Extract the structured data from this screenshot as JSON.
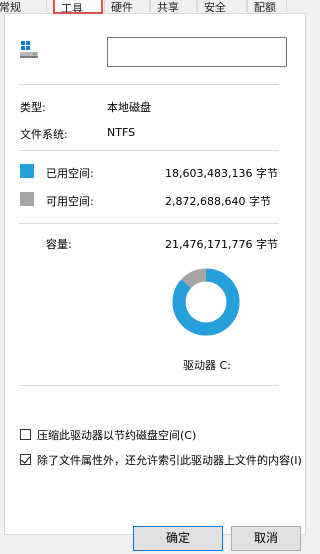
{
  "tabs": [
    {
      "label": "常规"
    },
    {
      "label": "工具"
    },
    {
      "label": "硬件"
    },
    {
      "label": "共享"
    },
    {
      "label": "安全"
    },
    {
      "label": "配额"
    }
  ],
  "drive_name_value": "",
  "type": {
    "label": "类型:",
    "value": "本地磁盘"
  },
  "filesystem": {
    "label": "文件系统:",
    "value": "NTFS"
  },
  "used": {
    "label": "已用空间:",
    "value": "18,603,483,136 字节",
    "color": "#26a0da"
  },
  "free": {
    "label": "可用空间:",
    "value": "2,872,688,640 字节",
    "color": "#a6a6a6"
  },
  "capacity": {
    "label": "容量:",
    "value": "21,476,171,776 字节"
  },
  "usage_fraction_used": 0.8662,
  "drive_label": "驱动器 C:",
  "compress": {
    "label": "压缩此驱动器以节约磁盘空间(C)",
    "checked": false
  },
  "index": {
    "label": "除了文件属性外，还允许索引此驱动器上文件的内容(I)",
    "checked": true
  },
  "buttons": {
    "ok": "确定",
    "cancel": "取消"
  }
}
